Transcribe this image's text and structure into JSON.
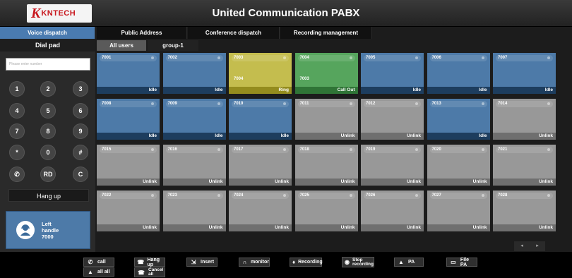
{
  "header": {
    "logo_text": "KNTECH",
    "title": "United Communication PABX"
  },
  "tabs": [
    {
      "label": "Voice dispatch",
      "active": true
    },
    {
      "label": "Public Address",
      "active": false
    },
    {
      "label": "Conference dispatch",
      "active": false
    },
    {
      "label": "Recording management",
      "active": false
    }
  ],
  "sidebar": {
    "title": "Dial pad",
    "input_placeholder": "Please enter number",
    "keys": [
      "1",
      "2",
      "3",
      "4",
      "5",
      "6",
      "7",
      "8",
      "9",
      "*",
      "0",
      "#",
      "",
      "RD",
      "C"
    ],
    "hangup_label": "Hang up",
    "handle": {
      "line1": "Left",
      "line2": "handle",
      "line3": "7000"
    }
  },
  "subtabs": [
    {
      "label": "All users",
      "active": true
    },
    {
      "label": "group-1",
      "active": false
    }
  ],
  "extensions": [
    {
      "ext": "7001",
      "peer": "",
      "status": "Idle",
      "state": "idle"
    },
    {
      "ext": "7002",
      "peer": "",
      "status": "Idle",
      "state": "idle"
    },
    {
      "ext": "7003",
      "peer": "7004",
      "status": "Ring",
      "state": "ring"
    },
    {
      "ext": "7004",
      "peer": "7003",
      "status": "Call Out",
      "state": "callout"
    },
    {
      "ext": "7005",
      "peer": "",
      "status": "Idle",
      "state": "idle"
    },
    {
      "ext": "7006",
      "peer": "",
      "status": "Idle",
      "state": "idle"
    },
    {
      "ext": "7007",
      "peer": "",
      "status": "Idle",
      "state": "idle"
    },
    {
      "ext": "7008",
      "peer": "",
      "status": "Idle",
      "state": "idle"
    },
    {
      "ext": "7009",
      "peer": "",
      "status": "Idle",
      "state": "idle"
    },
    {
      "ext": "7010",
      "peer": "",
      "status": "Idle",
      "state": "idle"
    },
    {
      "ext": "7011",
      "peer": "",
      "status": "Unlink",
      "state": "unlink"
    },
    {
      "ext": "7012",
      "peer": "",
      "status": "Unlink",
      "state": "unlink"
    },
    {
      "ext": "7013",
      "peer": "",
      "status": "Idle",
      "state": "idle"
    },
    {
      "ext": "7014",
      "peer": "",
      "status": "Unlink",
      "state": "unlink"
    },
    {
      "ext": "7015",
      "peer": "",
      "status": "Unlink",
      "state": "unlink"
    },
    {
      "ext": "7016",
      "peer": "",
      "status": "Unlink",
      "state": "unlink"
    },
    {
      "ext": "7017",
      "peer": "",
      "status": "Unlink",
      "state": "unlink"
    },
    {
      "ext": "7018",
      "peer": "",
      "status": "Unlink",
      "state": "unlink"
    },
    {
      "ext": "7019",
      "peer": "",
      "status": "Unlink",
      "state": "unlink"
    },
    {
      "ext": "7020",
      "peer": "",
      "status": "Unlink",
      "state": "unlink"
    },
    {
      "ext": "7021",
      "peer": "",
      "status": "Unlink",
      "state": "unlink"
    },
    {
      "ext": "7022",
      "peer": "",
      "status": "Unlink",
      "state": "unlink"
    },
    {
      "ext": "7023",
      "peer": "",
      "status": "Unlink",
      "state": "unlink"
    },
    {
      "ext": "7024",
      "peer": "",
      "status": "Unlink",
      "state": "unlink"
    },
    {
      "ext": "7025",
      "peer": "",
      "status": "Unlink",
      "state": "unlink"
    },
    {
      "ext": "7026",
      "peer": "",
      "status": "Unlink",
      "state": "unlink"
    },
    {
      "ext": "7027",
      "peer": "",
      "status": "Unlink",
      "state": "unlink"
    },
    {
      "ext": "7028",
      "peer": "",
      "status": "Unlink",
      "state": "unlink"
    }
  ],
  "pager": {
    "prev": "◂",
    "next": "▸"
  },
  "actions": {
    "call": "call",
    "hang_up": "Hang up",
    "insert": "Insert",
    "monitor": "monitor",
    "recording": "Recording",
    "stop_recording_1": "Stop",
    "stop_recording_2": "recording",
    "pa": "PA",
    "file_pa": "File PA",
    "all_all": "all all",
    "cancel_all_1": "Cancel",
    "cancel_all_2": "all"
  },
  "colors": {
    "idle": "#4d7aa8",
    "ring": "#c4bd4e",
    "callout": "#56a55d",
    "unlink": "#989898",
    "tab_active": "#4a7bb0",
    "brand": "#c8161d"
  },
  "icons": [
    "phone-icon",
    "hangup-icon",
    "insert-icon",
    "headphone-icon",
    "microphone-icon",
    "stop-icon",
    "speaker-icon",
    "file-icon",
    "group-icon",
    "cancel-icon",
    "operator-icon",
    "handset-icon"
  ]
}
